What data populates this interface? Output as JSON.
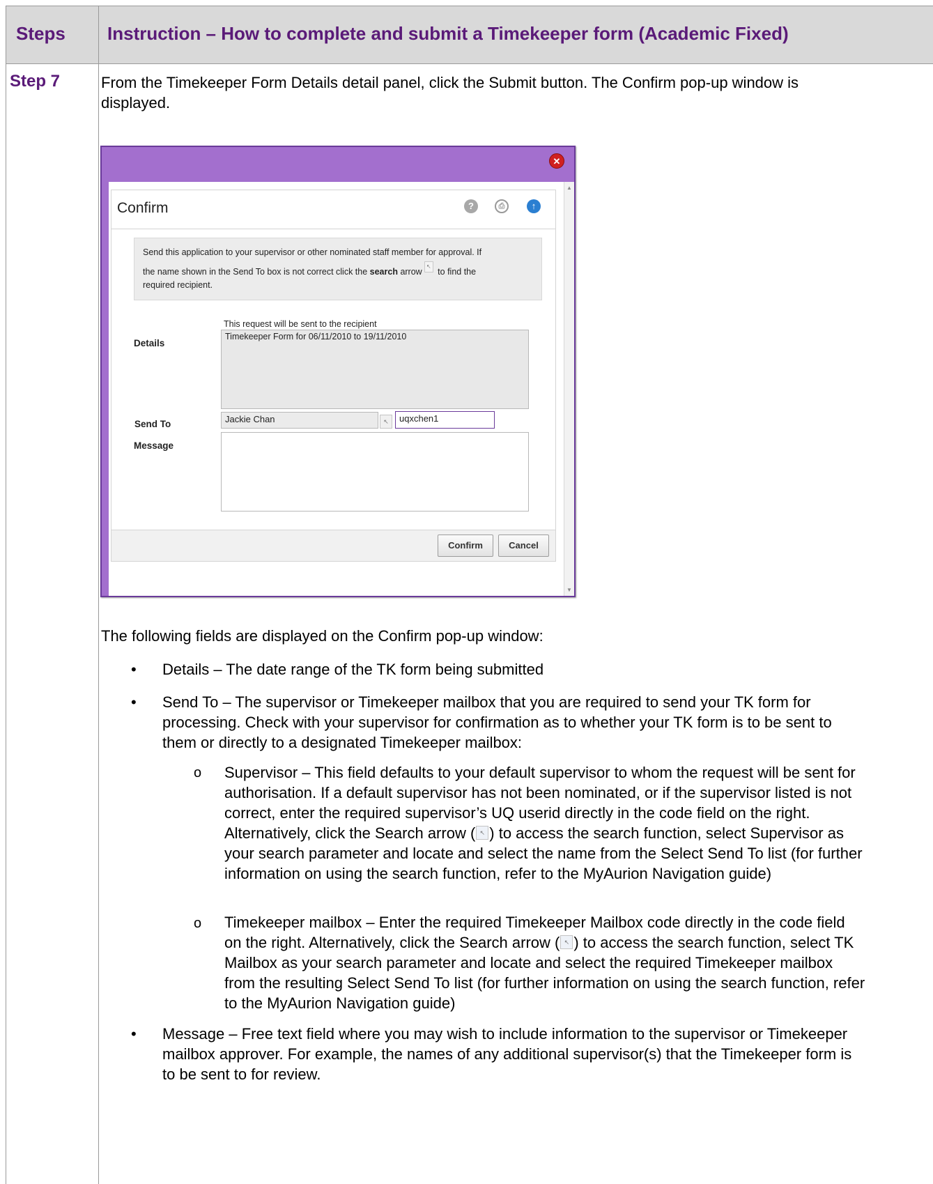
{
  "table": {
    "col1_header": "Steps",
    "col2_header": "Instruction – How to complete and submit a Timekeeper form (Academic Fixed)",
    "step_label": "Step 7",
    "intro": "From the Timekeeper Form Details detail panel, click the Submit button. The Confirm pop-up window is displayed."
  },
  "dialog": {
    "heading": "Confirm",
    "info_line1": "Send this application to your supervisor or other nominated staff member for approval. If",
    "info_line2_a": "the name shown in the Send To box is not correct click the ",
    "info_line2_bold": "search",
    "info_line2_b": " arrow",
    "info_line2_c": " to find the",
    "info_line3": "required recipient.",
    "note": "This request will be sent to the recipient",
    "details_label": "Details",
    "details_value": "Timekeeper Form for 06/11/2010 to 19/11/2010",
    "send_to_label": "Send To",
    "send_to_value": "Jackie Chan",
    "code_value": "uqxchen1",
    "message_label": "Message",
    "confirm_button": "Confirm",
    "cancel_button": "Cancel"
  },
  "explanation": {
    "lead": "The following fields are displayed on the Confirm pop-up window:",
    "bullet_details": "Details – The date range of the TK form being submitted",
    "bullet_sendto": "Send To – The supervisor or Timekeeper mailbox that you are required to send your TK form for processing. Check with your supervisor for confirmation as to whether your TK form is to be sent to them or directly to a designated Timekeeper mailbox:",
    "sub_supervisor_a": "Supervisor – This field defaults to your default supervisor to whom the request will be sent for authorisation. If a default supervisor has not been nominated, or if the supervisor listed is not correct, enter the required supervisor’s UQ userid directly in the code field on the right. Alternatively, click the Search arrow (",
    "sub_supervisor_b": ") to access the search function, select Supervisor as your search parameter and locate and select the name from the Select Send To list (for further information on using the search function, refer to the MyAurion Navigation guide)",
    "sub_mailbox_a": "Timekeeper mailbox – Enter the required Timekeeper Mailbox code directly in the code field on the right. Alternatively, click the Search arrow (",
    "sub_mailbox_b": ") to access the search function, select TK Mailbox as your search parameter and locate and select the required Timekeeper mailbox from the resulting Select Send To list (for further information on using the search function, refer to the MyAurion Navigation guide)",
    "bullet_message": "Message – Free text field where you may wish to include information to the supervisor or Timekeeper mailbox approver. For example, the names of any additional supervisor(s) that the Timekeeper form is to be sent to for review."
  },
  "colors": {
    "heading_purple": "#5a1a78",
    "titlebar_purple": "#a36fce",
    "header_gray": "#d9d9d9"
  },
  "icons": [
    "close-icon",
    "help-icon",
    "print-icon",
    "back-to-top-icon",
    "search-arrow-icon",
    "bullet-icon"
  ]
}
